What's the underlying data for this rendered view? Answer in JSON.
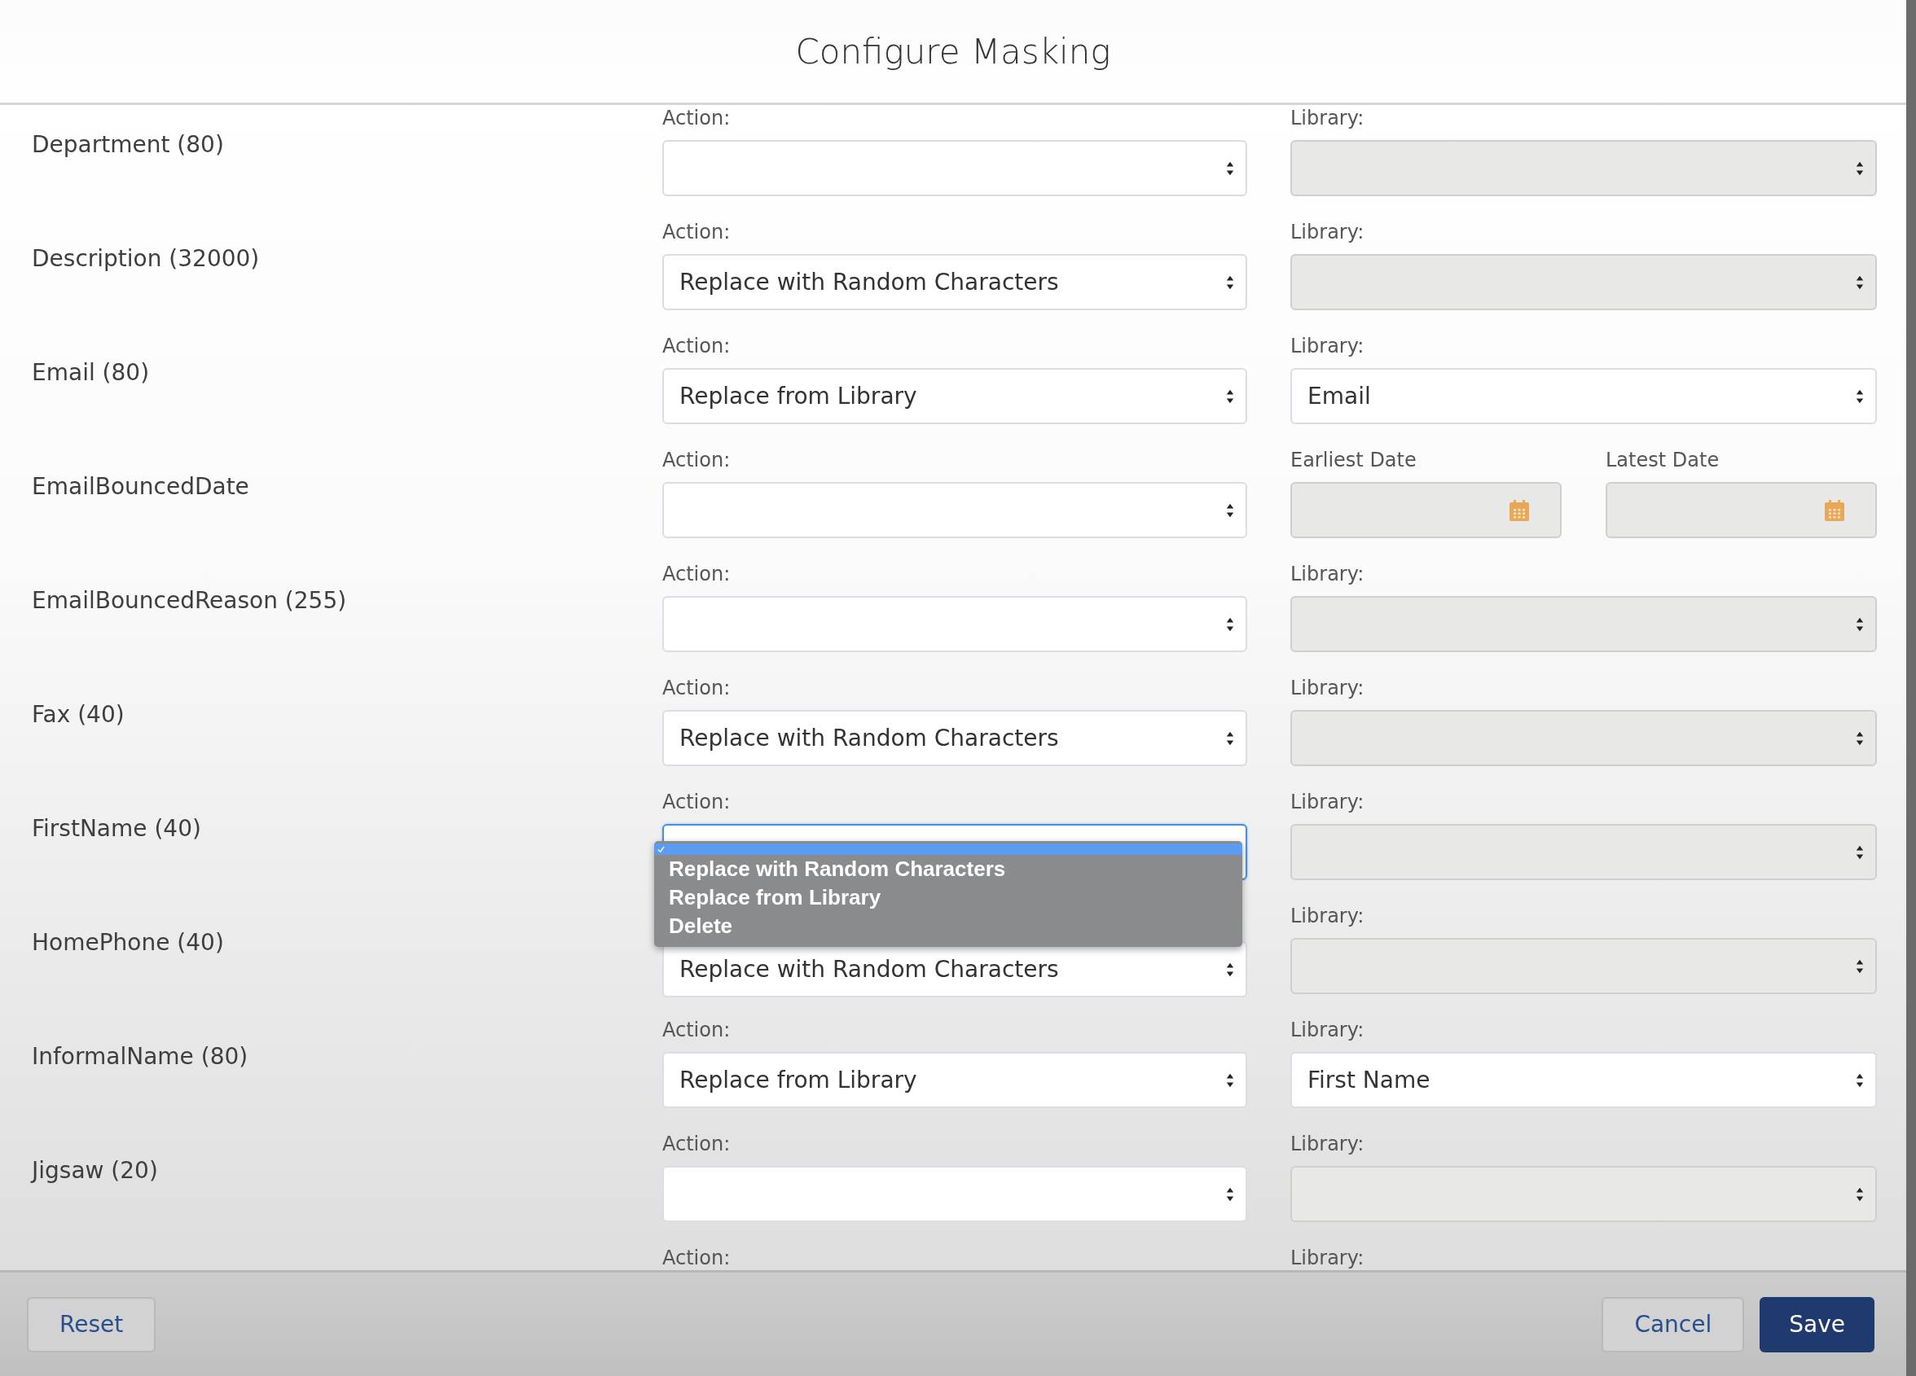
{
  "window": {
    "title": "Configure Masking"
  },
  "rows": [
    {
      "field": "Department (80)",
      "action": {
        "label": "Action:",
        "open": false
      },
      "library": {
        "kind": "select",
        "label": "Library:",
        "disabled": true
      }
    },
    {
      "field": "Description (32000)",
      "action": {
        "label": "Action:",
        "value": "Replace with Random Characters",
        "open": false
      },
      "library": {
        "kind": "select",
        "label": "Library:",
        "disabled": true
      }
    },
    {
      "field": "Email (80)",
      "action": {
        "label": "Action:",
        "value": "Replace from Library",
        "open": false
      },
      "library": {
        "kind": "select",
        "label": "Library:",
        "value": "Email",
        "disabled": false
      }
    },
    {
      "field": "EmailBouncedDate",
      "action": {
        "label": "Action:",
        "open": false
      },
      "library": {
        "kind": "dates",
        "dates": [
          {
            "label": "Earliest Date",
            "disabled": true
          },
          {
            "label": "Latest Date",
            "disabled": true
          }
        ]
      }
    },
    {
      "field": "EmailBouncedReason (255)",
      "action": {
        "label": "Action:",
        "open": false
      },
      "library": {
        "kind": "select",
        "label": "Library:",
        "disabled": true
      }
    },
    {
      "field": "Fax (40)",
      "action": {
        "label": "Action:",
        "value": "Replace with Random Characters",
        "open": false
      },
      "library": {
        "kind": "select",
        "label": "Library:",
        "disabled": true
      }
    },
    {
      "field": "FirstName (40)",
      "action": {
        "label": "Action:",
        "open": true,
        "empty_option_selected": true,
        "options": [
          {
            "label": "Replace with Random Characters",
            "selected": false
          },
          {
            "label": "Replace from Library",
            "selected": false
          },
          {
            "label": "Delete",
            "selected": false
          }
        ]
      },
      "library": {
        "kind": "select",
        "label": "Library:",
        "disabled": true
      }
    },
    {
      "field": "HomePhone (40)",
      "action": {
        "value": "Replace with Random Characters",
        "open": false
      },
      "library": {
        "kind": "select",
        "label": "Library:",
        "disabled": true
      }
    },
    {
      "field": "InformalName (80)",
      "action": {
        "label": "Action:",
        "value": "Replace from Library",
        "open": false
      },
      "library": {
        "kind": "select",
        "label": "Library:",
        "value": "First Name",
        "disabled": false
      }
    },
    {
      "field": "Jigsaw (20)",
      "action": {
        "label": "Action:",
        "open": false
      },
      "library": {
        "kind": "select",
        "label": "Library:",
        "disabled": true
      }
    },
    {
      "action": {
        "label": "Action:"
      },
      "library": {
        "kind": "select",
        "label": "Library:"
      }
    }
  ],
  "footer": {
    "buttons": [
      {
        "label": "Reset",
        "kind": "neutral"
      },
      {
        "label": "Cancel",
        "kind": "neutral"
      },
      {
        "label": "Save",
        "kind": "brand"
      }
    ]
  }
}
